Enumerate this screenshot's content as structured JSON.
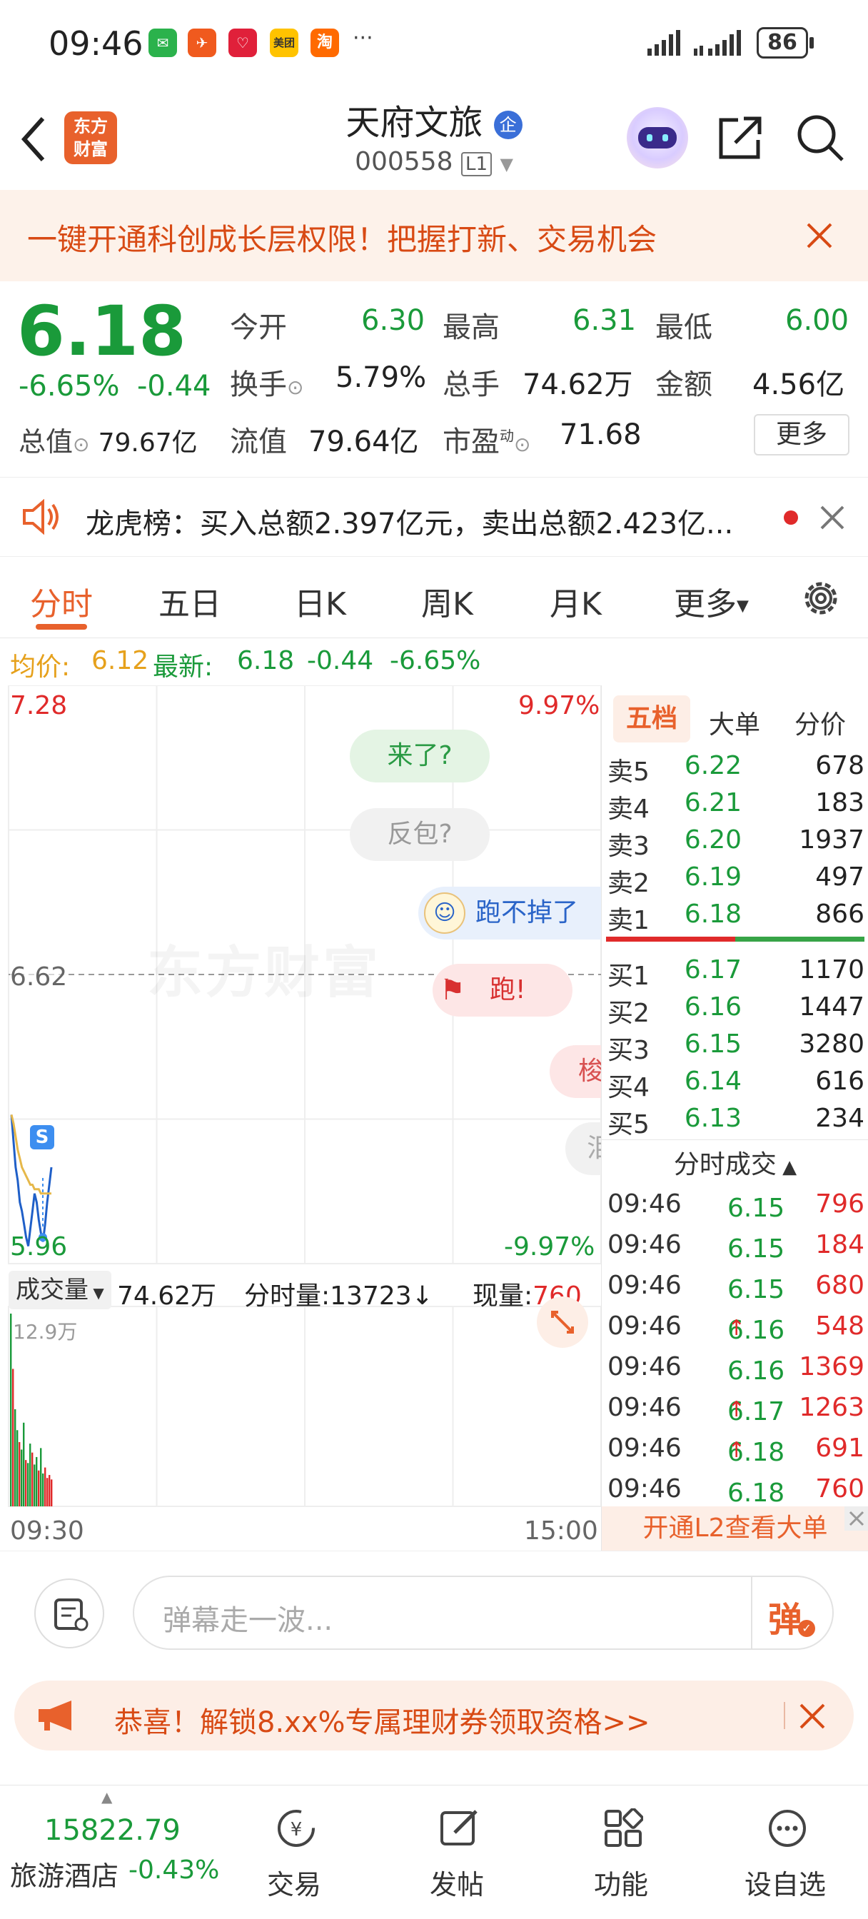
{
  "status_bar": {
    "time": "09:46",
    "battery": "86",
    "more": "···"
  },
  "header": {
    "title": "天府文旅",
    "verified": "企",
    "code": "000558",
    "level": "L1",
    "logo_line1": "东方",
    "logo_line2": "财富"
  },
  "banner": {
    "text": "一键开通科创成长层权限！把握打新、交易机会"
  },
  "quote": {
    "price": "6.18",
    "change_pct": "-6.65%",
    "change": "-0.44",
    "open_label": "今开",
    "open": "6.30",
    "high_label": "最高",
    "high": "6.31",
    "low_label": "最低",
    "low": "6.00",
    "turnover_label": "换手",
    "turnover": "5.79%",
    "volume_label": "总手",
    "volume": "74.62万",
    "amount_label": "金额",
    "amount": "4.56亿",
    "mktcap_label": "总值",
    "mktcap": "79.67亿",
    "float_label": "流值",
    "float_cap": "79.64亿",
    "pe_label": "市盈",
    "pe_sup": "动",
    "pe": "71.68",
    "more_button": "更多"
  },
  "lhb": {
    "text": "龙虎榜：买入总额2.397亿元，卖出总额2.423亿..."
  },
  "tabs": [
    "分时",
    "五日",
    "日K",
    "周K",
    "月K",
    "更多"
  ],
  "avg_line": {
    "avg_label": "均价:",
    "avg": "6.12",
    "latest_label": "最新:",
    "latest": "6.18",
    "change": "-0.44",
    "pct": "-6.65%"
  },
  "chart": {
    "y_top": "7.28",
    "y_mid": "6.62",
    "y_bottom": "5.96",
    "pct_top": "9.97%",
    "pct_bottom": "-9.97%",
    "watermark": "东方财富",
    "marker": "S",
    "bubbles": [
      "来了?",
      "反包?",
      "跑不掉了",
      "跑!",
      "梭",
      "泪"
    ],
    "vol_label": "成交量",
    "vol_total": "74.62万",
    "minute_vol_label": "分时量:",
    "minute_vol": "13723↓",
    "cur_vol_label": "现量:",
    "cur_vol": "760",
    "vol_max": "12.9万",
    "t_start": "09:30",
    "t_end": "15:00"
  },
  "chart_data": {
    "type": "line",
    "title": "",
    "xlabel": "",
    "ylabel": "",
    "ylim": [
      5.96,
      7.28
    ],
    "series": [
      {
        "name": "",
        "values": [
          6.3,
          6.24,
          6.18,
          6.15,
          6.1,
          6.08,
          6.05,
          6.02,
          6.0,
          6.04,
          6.08,
          6.12,
          6.1,
          6.06,
          6.03,
          6.01,
          6.05,
          6.1,
          6.14,
          6.18
        ]
      },
      {
        "name": "",
        "values": [
          6.3,
          6.28,
          6.25,
          6.22,
          6.2,
          6.18,
          6.17,
          6.16,
          6.15,
          6.14,
          6.14,
          6.13,
          6.13,
          6.13,
          6.12,
          6.12,
          6.12,
          6.12,
          6.12,
          6.12
        ]
      }
    ],
    "volumes": [
      12.9,
      9.2,
      6.5,
      5.1,
      4.3,
      3.8,
      5.6,
      3.1,
      2.9,
      4.2,
      3.6,
      2.8,
      3.3,
      2.4,
      3.9,
      2.2,
      2.6,
      1.9,
      2.1,
      1.8
    ]
  },
  "orderbook": {
    "tabs": [
      "五档",
      "大单",
      "分价"
    ],
    "sells": [
      {
        "label": "卖5",
        "price": "6.22",
        "vol": "678"
      },
      {
        "label": "卖4",
        "price": "6.21",
        "vol": "183"
      },
      {
        "label": "卖3",
        "price": "6.20",
        "vol": "1937"
      },
      {
        "label": "卖2",
        "price": "6.19",
        "vol": "497"
      },
      {
        "label": "卖1",
        "price": "6.18",
        "vol": "866"
      }
    ],
    "buys": [
      {
        "label": "买1",
        "price": "6.17",
        "vol": "1170"
      },
      {
        "label": "买2",
        "price": "6.16",
        "vol": "1447"
      },
      {
        "label": "买3",
        "price": "6.15",
        "vol": "3280"
      },
      {
        "label": "买4",
        "price": "6.14",
        "vol": "616"
      },
      {
        "label": "买5",
        "price": "6.13",
        "vol": "234"
      }
    ],
    "ticks_title": "分时成交",
    "ticks": [
      {
        "time": "09:46",
        "price": "6.15",
        "arrow": "",
        "vol": "796"
      },
      {
        "time": "09:46",
        "price": "6.15",
        "arrow": "",
        "vol": "184"
      },
      {
        "time": "09:46",
        "price": "6.15",
        "arrow": "",
        "vol": "680"
      },
      {
        "time": "09:46",
        "price": "6.16",
        "arrow": "↑",
        "vol": "548"
      },
      {
        "time": "09:46",
        "price": "6.16",
        "arrow": "",
        "vol": "1369"
      },
      {
        "time": "09:46",
        "price": "6.17",
        "arrow": "↑",
        "vol": "1263"
      },
      {
        "time": "09:46",
        "price": "6.18",
        "arrow": "↑",
        "vol": "691"
      },
      {
        "time": "09:46",
        "price": "6.18",
        "arrow": "",
        "vol": "760"
      }
    ],
    "l2_link": "开通L2查看大单"
  },
  "comment": {
    "placeholder": "弹幕走一波...",
    "send": "弹"
  },
  "promo": {
    "text": "恭喜！解锁8.xx%专属理财券领取资格>>"
  },
  "bottom": {
    "index_value": "15822.79",
    "index_name": "旅游酒店",
    "index_pct": "-0.43%",
    "items": [
      "交易",
      "发帖",
      "功能",
      "设自选"
    ]
  },
  "colors": {
    "red": "#e02a2a",
    "green": "#1a9a3a",
    "orange": "#e8612c",
    "blue": "#2a64c8"
  }
}
